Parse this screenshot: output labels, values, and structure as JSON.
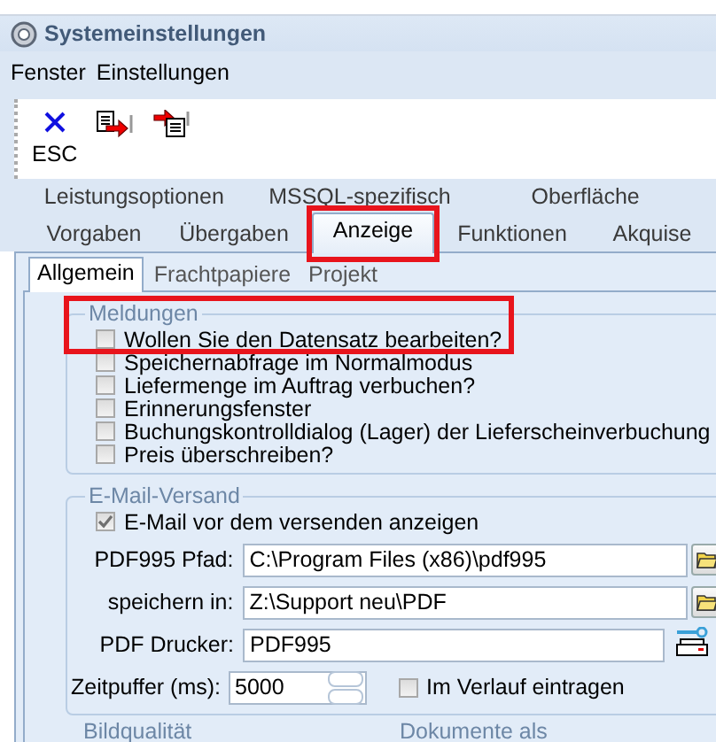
{
  "window": {
    "title": "Systemeinstellungen"
  },
  "menu": [
    "Fenster",
    "Einstellungen"
  ],
  "toolbar": [
    {
      "kind": "close",
      "label": "ESC"
    },
    {
      "kind": "export"
    },
    {
      "kind": "import"
    }
  ],
  "tabs_row1": [
    {
      "label": "Leistungsoptionen",
      "selected": false
    },
    {
      "label": "MSSQL-spezifisch",
      "selected": false
    },
    {
      "label": "Oberfläche",
      "selected": false
    }
  ],
  "tabs_row2": [
    {
      "label": "Vorgaben",
      "selected": false
    },
    {
      "label": "Übergaben",
      "selected": false
    },
    {
      "label": "Anzeige",
      "selected": true,
      "highlighted": true
    },
    {
      "label": "Funktionen",
      "selected": false
    },
    {
      "label": "Akquise",
      "selected": false
    }
  ],
  "subtabs": [
    {
      "label": "Allgemein",
      "selected": true
    },
    {
      "label": "Frachtpapiere",
      "selected": false
    },
    {
      "label": "Projekt",
      "selected": false
    }
  ],
  "meldungen": {
    "title": "Meldungen",
    "highlighted": true,
    "items": [
      {
        "label": "Wollen Sie den Datensatz bearbeiten?",
        "checked": false
      },
      {
        "label": "Speichernabfrage im Normalmodus",
        "checked": false
      },
      {
        "label": "Liefermenge im Auftrag verbuchen?",
        "checked": false
      },
      {
        "label": "Erinnerungsfenster",
        "checked": false
      },
      {
        "label": "Buchungskontrolldialog (Lager) der Lieferscheinverbuchung",
        "checked": false
      },
      {
        "label": "Preis überschreiben?",
        "checked": false
      }
    ]
  },
  "email": {
    "title": "E-Mail-Versand",
    "show_before_send": {
      "label": "E-Mail vor dem versenden anzeigen",
      "checked": true
    },
    "fields": [
      {
        "label": "PDF995 Pfad:",
        "value": "C:\\Program Files (x86)\\pdf995",
        "kind": "folder"
      },
      {
        "label": "speichern in:",
        "value": "Z:\\Support neu\\PDF",
        "kind": "folder"
      },
      {
        "label": "PDF Drucker:",
        "value": "PDF995",
        "kind": "printer"
      }
    ],
    "timeout": {
      "label": "Zeitpuffer (ms):",
      "value": "5000"
    },
    "log": {
      "label": "Im Verlauf eintragen",
      "checked": false
    }
  },
  "next_groups": [
    "Bildqualität",
    "Dokumente als"
  ]
}
